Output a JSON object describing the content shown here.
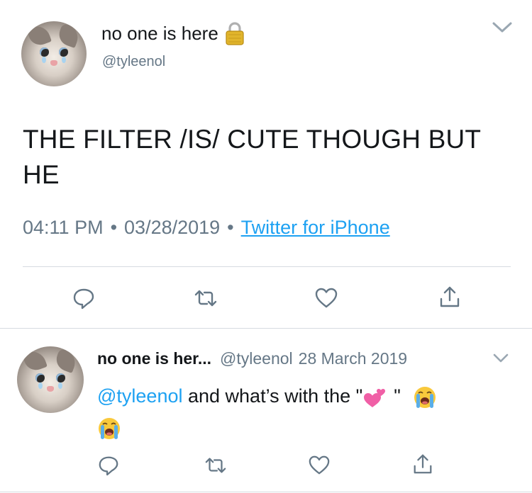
{
  "tweet": {
    "author_name": "no one is here",
    "author_handle": "@tyleenol",
    "text": "THE FILTER /IS/ CUTE THOUGH BUT HE",
    "time": "04:11 PM",
    "date": "03/28/2019",
    "separator": "•",
    "source": "Twitter for iPhone",
    "locked": true
  },
  "reply": {
    "author_name": "no one is her...",
    "author_handle": "@tyleenol",
    "date": "28 March 2019",
    "mention": "@tyleenol",
    "text": " and what’s with the \"",
    "text_end": "\"",
    "emoji_1": "two-hearts",
    "emoji_2": "loudly-crying-face",
    "emoji_3": "loudly-crying-face"
  },
  "icons": {
    "reply": "reply-icon",
    "retweet": "retweet-icon",
    "like": "heart-icon",
    "share": "share-icon",
    "lock": "lock-icon",
    "chevron": "chevron-down-icon"
  },
  "colors": {
    "text": "#14171a",
    "secondary": "#657786",
    "link": "#1da1f2",
    "divider": "#d6dbe0"
  }
}
